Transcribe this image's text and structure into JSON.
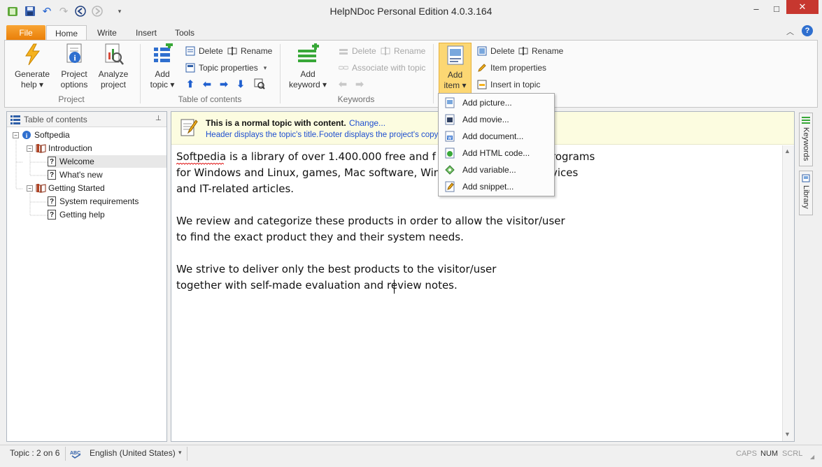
{
  "window": {
    "title": "HelpNDoc Personal Edition 4.0.3.164",
    "minimize": "–",
    "maximize": "□",
    "close": "✕"
  },
  "tabs": [
    "File",
    "Home",
    "Write",
    "Insert",
    "Tools"
  ],
  "ribbon": {
    "project": {
      "label": "Project",
      "generate_help": [
        "Generate",
        "help ▾"
      ],
      "project_options": [
        "Project",
        "options"
      ],
      "analyze_project": [
        "Analyze",
        "project"
      ]
    },
    "toc": {
      "label": "Table of contents",
      "add_topic": [
        "Add",
        "topic ▾"
      ],
      "delete": "Delete",
      "rename": "Rename",
      "topic_properties": "Topic properties",
      "topic_properties_arrow": "▾"
    },
    "keywords": {
      "label": "Keywords",
      "add_keyword": [
        "Add",
        "keyword ▾"
      ],
      "delete": "Delete",
      "rename": "Rename",
      "associate": "Associate with topic"
    },
    "library": {
      "add_item": [
        "Add",
        "item ▾"
      ],
      "delete": "Delete",
      "rename": "Rename",
      "item_properties": "Item properties",
      "insert_in_topic": "Insert in topic"
    }
  },
  "toc_panel": {
    "header": "Table of contents",
    "pin": "📌",
    "nodes": [
      {
        "label": "Softpedia"
      },
      {
        "label": "Introduction"
      },
      {
        "label": "Welcome"
      },
      {
        "label": "What's new"
      },
      {
        "label": "Getting Started"
      },
      {
        "label": "System requirements"
      },
      {
        "label": "Getting help"
      }
    ]
  },
  "editor": {
    "info_title": "This is a normal topic with content.",
    "info_change": "Change...",
    "info_header": "Header displays the topic's title.",
    "info_footer": "Footer displays the project's copyrig",
    "lines": [
      "Softpedia is a library of over 1.400.000 free and f",
      "rograms",
      "for Windows and Linux, games, Mac software, Wind",
      "vices",
      "and IT-related articles.",
      "We review and categorize these products in order to allow the visitor/user",
      "to find the exact product they and their system needs.",
      "We strive to deliver only the best products to the visitor/user",
      "together with self-made evaluation and review notes."
    ]
  },
  "side_tabs": [
    "Keywords",
    "Library"
  ],
  "dropdown": {
    "items": [
      {
        "label": "Add picture...",
        "icon": "picture-icon"
      },
      {
        "label": "Add movie...",
        "icon": "movie-icon"
      },
      {
        "label": "Add document...",
        "icon": "document-icon"
      },
      {
        "label": "Add HTML code...",
        "icon": "html-icon"
      },
      {
        "label": "Add variable...",
        "icon": "variable-icon"
      },
      {
        "label": "Add snippet...",
        "icon": "snippet-icon"
      }
    ]
  },
  "statusbar": {
    "topic": "Topic : 2 on 6",
    "language": "English (United States)",
    "caps": "CAPS",
    "num": "NUM",
    "scrl": "SCRL"
  },
  "colors": {
    "file_tab": "#e97d07",
    "add_item_active": "#fcd773",
    "info_bar": "#fcfce0",
    "link": "#1f4fd0"
  }
}
